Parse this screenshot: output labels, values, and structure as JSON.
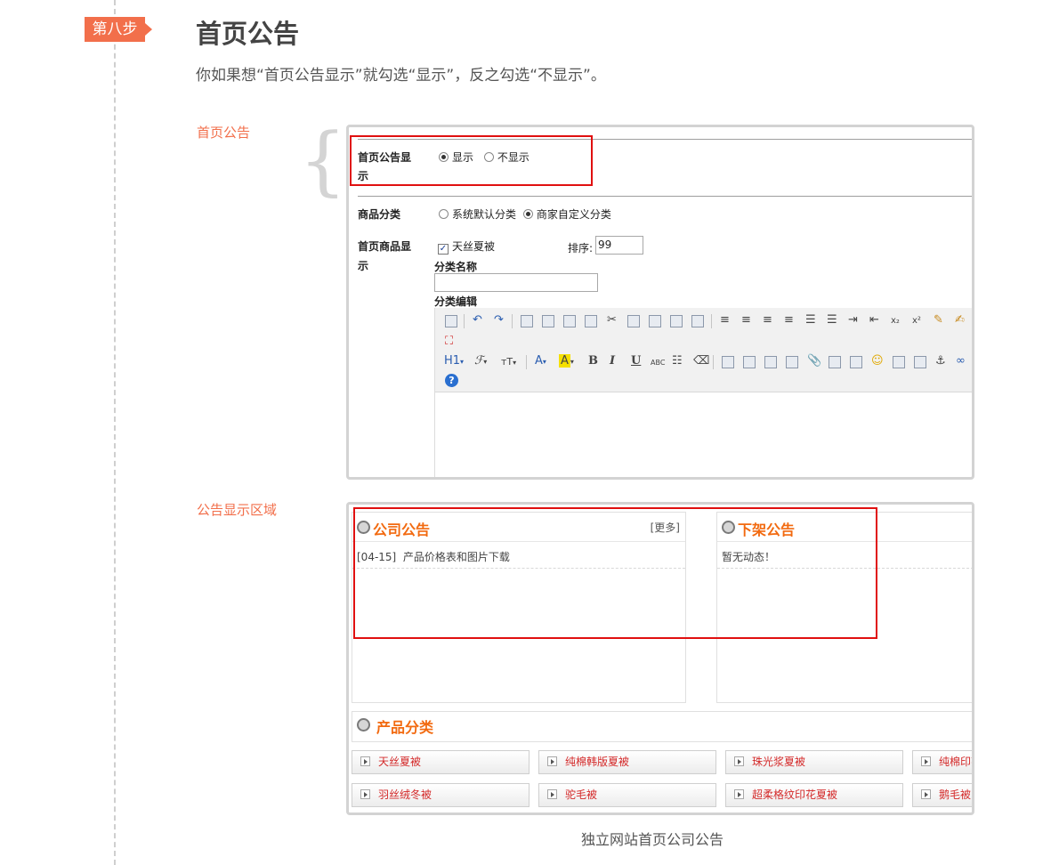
{
  "step": {
    "badge": "第八步",
    "title": "首页公告",
    "description": "你如果想“首页公告显示”就勾选“显示”，反之勾选“不显示”。"
  },
  "section1": {
    "label": "首页公告"
  },
  "settings": {
    "notice_display": {
      "label": "首页公告显",
      "label_wrap": "示",
      "options": [
        "显示",
        "不显示"
      ],
      "selected": "显示"
    },
    "product_category": {
      "label": "商品分类",
      "options": [
        "系统默认分类",
        "商家自定义分类"
      ],
      "selected": "商家自定义分类"
    },
    "home_products": {
      "label": "首页商品显",
      "label_wrap": "示",
      "checkbox_label": "天丝夏被",
      "checked": true,
      "sort_label": "排序:",
      "sort_value": "99",
      "category_name_label": "分类名称",
      "category_name_value": "",
      "category_edit_label": "分类编辑"
    }
  },
  "toolbar": {
    "h1": "H1",
    "bold": "B",
    "italic": "I",
    "underline": "U",
    "strike": "ABC",
    "font_color": "A",
    "highlight": "A",
    "sub": "x₂",
    "sup": "x²",
    "help": "?"
  },
  "section2": {
    "label": "公告显示区域"
  },
  "preview": {
    "company_notice": {
      "title": "公司公告",
      "more": "[更多]",
      "items": [
        {
          "date": "[04-15]",
          "text": "产品价格表和图片下载"
        }
      ]
    },
    "offline_notice": {
      "title": "下架公告",
      "empty_text": "暂无动态！"
    },
    "product_categories": {
      "title": "产品分类",
      "items": [
        "天丝夏被",
        "纯棉韩版夏被",
        "珠光浆夏被",
        "纯棉印花",
        "羽丝绒冬被",
        "驼毛被",
        "超柔格纹印花夏被",
        "鹅毛被"
      ]
    }
  },
  "caption": "独立网站首页公司公告",
  "colors": {
    "accent": "#f26f4b",
    "highlight_box": "#e01010",
    "panel_title": "#f26a10",
    "category_text": "#d42a2a"
  }
}
